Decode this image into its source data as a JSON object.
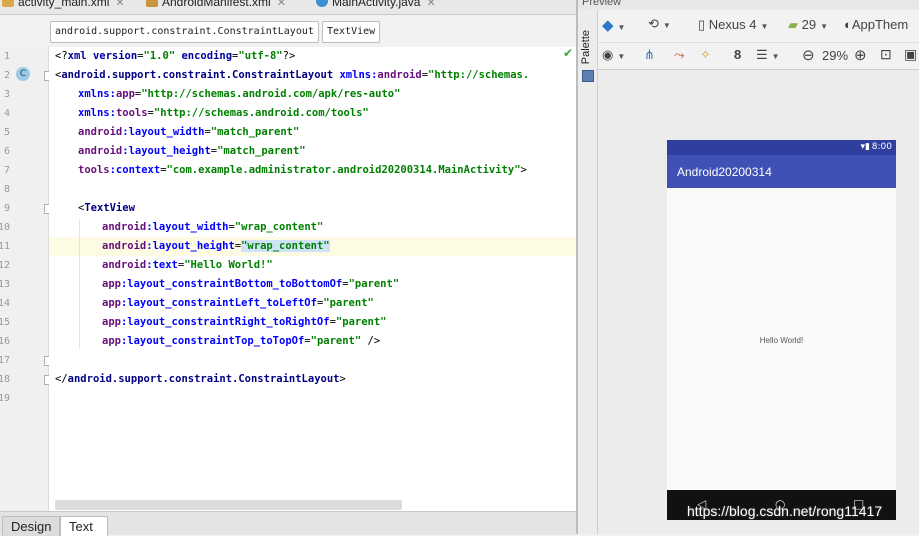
{
  "tabs": [
    {
      "label": "activity_main.xml",
      "icon": "xml-file-icon"
    },
    {
      "label": "AndroidManifest.xml",
      "icon": "manifest-file-icon"
    },
    {
      "label": "MainActivity.java",
      "icon": "java-class-icon"
    }
  ],
  "breadcrumb": [
    "android.support.constraint.ConstraintLayout",
    "TextView"
  ],
  "code": {
    "line_numbers": [
      "1",
      "2",
      "3",
      "4",
      "5",
      "6",
      "7",
      "8",
      "9",
      "10",
      "11",
      "12",
      "13",
      "14",
      "15",
      "16",
      "17",
      "18",
      "19"
    ],
    "l1": {
      "a": "<?",
      "b": "xml version",
      "c": "=",
      "d": "\"1.0\"",
      "e": " encoding",
      "f": "=",
      "g": "\"utf-8\"",
      "h": "?>"
    },
    "l2": {
      "a": "<",
      "b": "android.support.constraint.ConstraintLayout",
      "c": " xmlns:",
      "d": "android",
      "e": "=",
      "f": "\"http://schemas."
    },
    "l3": {
      "a": "xmlns:",
      "b": "app",
      "c": "=",
      "d": "\"http://schemas.android.com/apk/res-auto\""
    },
    "l4": {
      "a": "xmlns:",
      "b": "tools",
      "c": "=",
      "d": "\"http://schemas.android.com/tools\""
    },
    "l5": {
      "a": "android",
      "b": ":layout_width",
      "c": "=",
      "d": "\"match_parent\""
    },
    "l6": {
      "a": "android",
      "b": ":layout_height",
      "c": "=",
      "d": "\"match_parent\""
    },
    "l7": {
      "a": "tools",
      "b": ":context",
      "c": "=",
      "d": "\"com.example.administrator.android20200314.MainActivity\"",
      "e": ">"
    },
    "l9": {
      "a": "<",
      "b": "TextView"
    },
    "l10": {
      "a": "android",
      "b": ":layout_width",
      "c": "=",
      "d": "\"wrap_content\""
    },
    "l11": {
      "a": "android",
      "b": ":layout_height",
      "c": "=",
      "d": "\"wrap_content\""
    },
    "l12": {
      "a": "android",
      "b": ":text",
      "c": "=",
      "d": "\"Hello World!\""
    },
    "l13": {
      "a": "app",
      "b": ":layout_constraintBottom_toBottomOf",
      "c": "=",
      "d": "\"parent\""
    },
    "l14": {
      "a": "app",
      "b": ":layout_constraintLeft_toLeftOf",
      "c": "=",
      "d": "\"parent\""
    },
    "l15": {
      "a": "app",
      "b": ":layout_constraintRight_toRightOf",
      "c": "=",
      "d": "\"parent\""
    },
    "l16": {
      "a": "app",
      "b": ":layout_constraintTop_toTopOf",
      "c": "=",
      "d": "\"parent\"",
      "e": " />"
    },
    "l18": {
      "a": "</",
      "b": "android.support.constraint.ConstraintLayout",
      "c": ">"
    }
  },
  "bottom_tabs": {
    "design": "Design",
    "text": "Text"
  },
  "preview": {
    "title": "Preview",
    "palette": "Palette",
    "device": "Nexus 4",
    "api": "29",
    "theme": "AppThem",
    "zoom": "29%",
    "toolbar_num": "8",
    "status_time": "8:00",
    "app_title": "Android20200314",
    "hello": "Hello World!"
  },
  "watermark": "https://blog.csdn.net/rong11417"
}
